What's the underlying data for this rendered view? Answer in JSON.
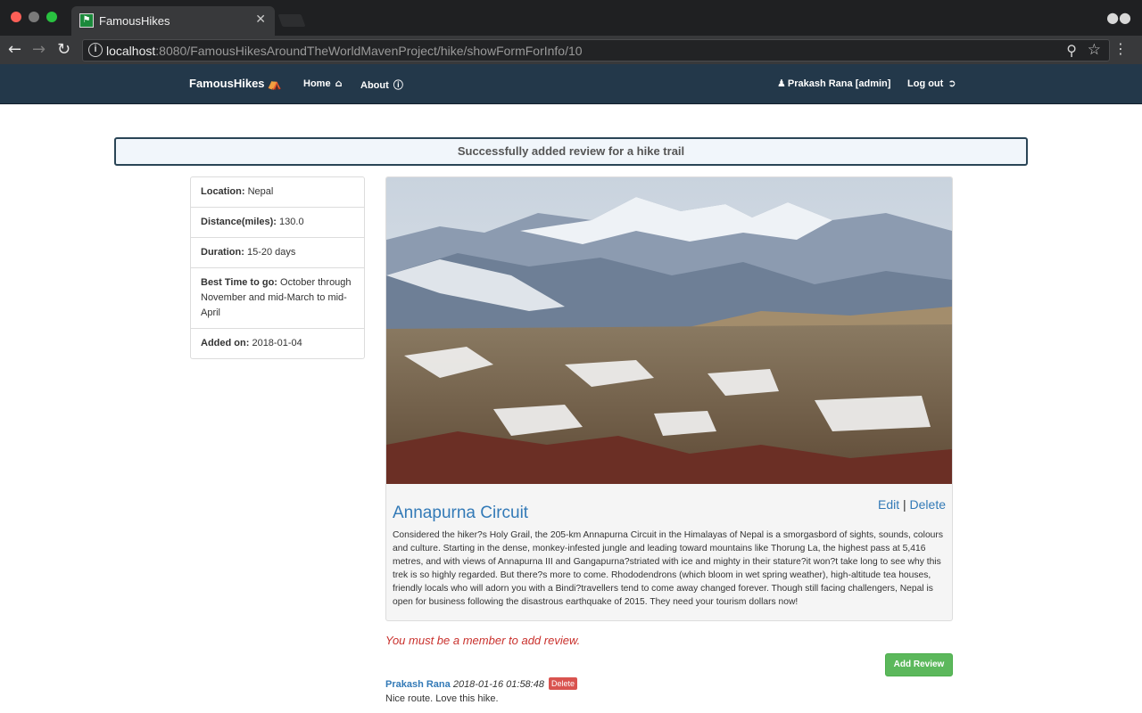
{
  "browser": {
    "tab_title": "FamousHikes",
    "url_host": "localhost",
    "url_path": ":8080/FamousHikesAroundTheWorldMavenProject/hike/showFormForInfo/10"
  },
  "nav": {
    "brand": "FamousHikes",
    "home": "Home",
    "about": "About",
    "user": "Prakash Rana [admin]",
    "logout": "Log out"
  },
  "alert": "Successfully added review for a hike trail",
  "details": {
    "location_label": "Location:",
    "location": "Nepal",
    "distance_label": "Distance(miles):",
    "distance": "130.0",
    "duration_label": "Duration:",
    "duration": "15-20 days",
    "best_time_label": "Best Time to go:",
    "best_time": "October through November and mid-March to mid-April",
    "added_label": "Added on:",
    "added": "2018-01-04"
  },
  "hike": {
    "title": "Annapurna Circuit",
    "edit": "Edit",
    "separator": "|",
    "delete": "Delete",
    "description": "Considered the hiker?s Holy Grail, the 205-km Annapurna Circuit in the Himalayas of Nepal is a smorgasbord of sights, sounds, colours and culture. Starting in the dense, monkey-infested jungle and leading toward mountains like Thorung La, the highest pass at 5,416 metres, and with views of Annapurna III and Gangapurna?striated with ice and mighty in their stature?it won?t take long to see why this trek is so highly regarded. But there?s more to come. Rhododendrons (which bloom in wet spring weather), high-altitude tea houses, friendly locals who will adorn you with a Bindi?travellers tend to come away changed forever. Though still facing challengers, Nepal is open for business following the disastrous earthquake of 2015. They need your tourism dollars now!"
  },
  "reviews_section": {
    "member_message": "You must be a member to add review.",
    "add_button": "Add Review"
  },
  "reviews": [
    {
      "author": "Prakash Rana",
      "date": "2018-01-16 01:58:48",
      "delete_label": "Delete",
      "text": "Nice route. Love this hike."
    }
  ],
  "colors": {
    "navbar": "#23384a",
    "link": "#337ab7",
    "success": "#5cb85c",
    "danger": "#d9534f"
  }
}
